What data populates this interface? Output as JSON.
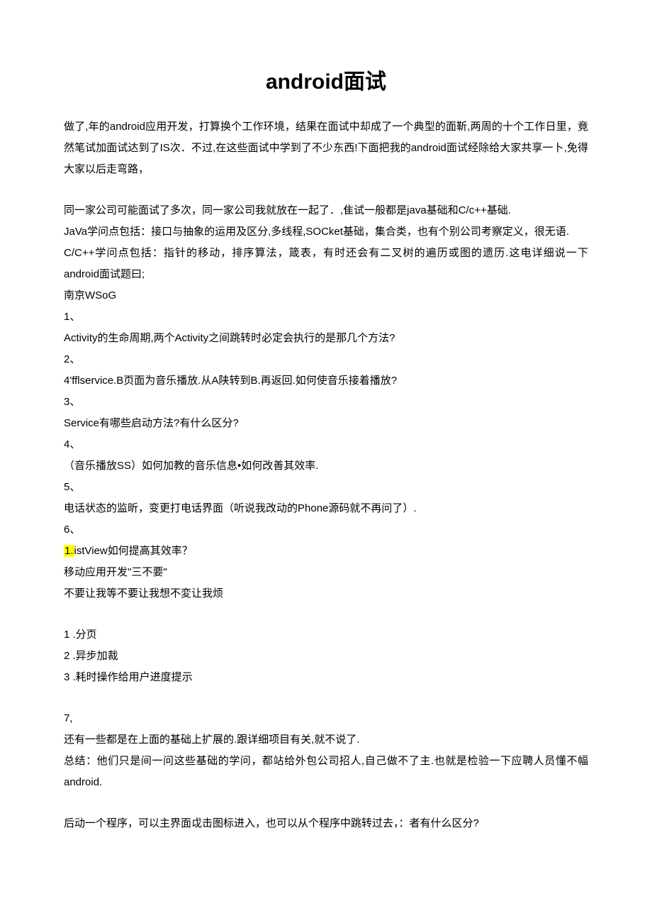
{
  "title": "android面试",
  "p1": "做了,年的android应用开发，打算换个工作环境，结果在面试中却成了一个典型的面靳,两周的十个工作日里，竟然笔试加面试达到了IS次．不过,在这些面试中学到了不少东西!下面把我的android面试经除给大家共享一卜,免得大家以后走弯路，",
  "p2": "同一家公司可能面试了多次，同一家公司我就放在一起了．,隹试一般都是java基础和C/c++基础.",
  "p3": "JaVa学问点包括：接口与抽象的运用及区分,多线程,SOCket基础，集合类，也有个别公司考察定义，很无语.",
  "p4": "C/C++学问点包括：指针的移动，排序算法，箴表，有时还会有二叉树的遍历或图的遗历.这电详细说一下android面试题曰;",
  "p5": "南京WSoG",
  "q1n": "1、",
  "q1": "Activity的生命周期,两个Activity之间跳转时必定会执行的是那几个方法?",
  "q2n": "2、",
  "q2": "4'fflservice.B页面为音乐播放.从A陕转到B.再返回.如何使音乐接着播放?",
  "q3n": "3、",
  "q3": "Service有哪些启动方法?有什么区分?",
  "q4n": "4、",
  "q4": "（音乐播放SS）如何加教的音乐信息•如何改善其效率.",
  "q5n": "5、",
  "q5": "电话状态的监昕，变更打电话界面（听说我改动的Phone源码就不再问了）.",
  "q6n": "6、",
  "q6hl": "1.",
  "q6rest": "istView如何提高其效率？",
  "q6a": "移动应用开发\"三不要\"",
  "q6b": "不要让我等不要让我想不変让我烦",
  "li1": "1  .分页",
  "li2": "2  .异步加裁",
  "li3": "3  .耗时操作给用户进度提示",
  "q7n": "7,",
  "q7a": "还有一些都是在上面的基础上扩展的.跟详细项目有关,就不说了.",
  "q7b": "总结：他们只是间一问这些基础的学问，都站给外包公司招人,自己做不了主.也就是检验一下应聘人员懂不幅android.",
  "p_last": "后动一个程序，可以主界面戉击图标进入，也可以从个程序中跳转过去，：者有什么区分?"
}
